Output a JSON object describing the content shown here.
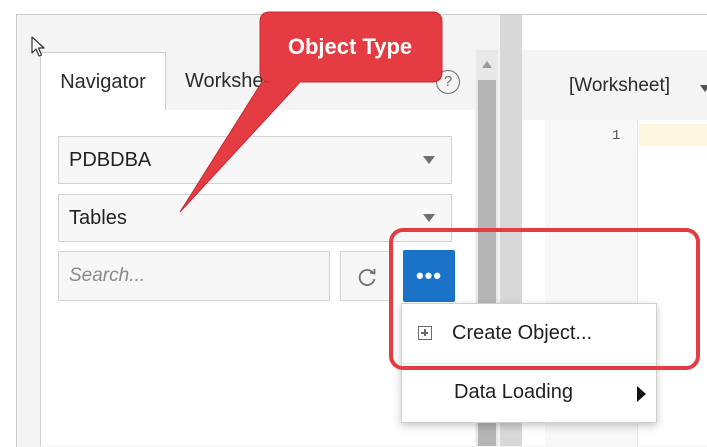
{
  "tabs": {
    "navigator": "Navigator",
    "worksheet": "Worksheet",
    "help_icon": "question-circle-icon"
  },
  "navigator": {
    "schema_value": "PDBDBA",
    "object_type_value": "Tables",
    "search_placeholder": "Search...",
    "refresh_icon": "refresh-icon",
    "more_icon": "more-actions-icon",
    "more_glyph": "•••"
  },
  "worksheet": {
    "selector": "[Worksheet]",
    "line_number": "1"
  },
  "context_menu": {
    "create_object": "Create Object...",
    "data_loading": "Data Loading"
  },
  "annotation": {
    "callout_text": "Object Type",
    "accent_color": "#e53b42"
  },
  "colors": {
    "primary_button": "#1a73c8"
  }
}
